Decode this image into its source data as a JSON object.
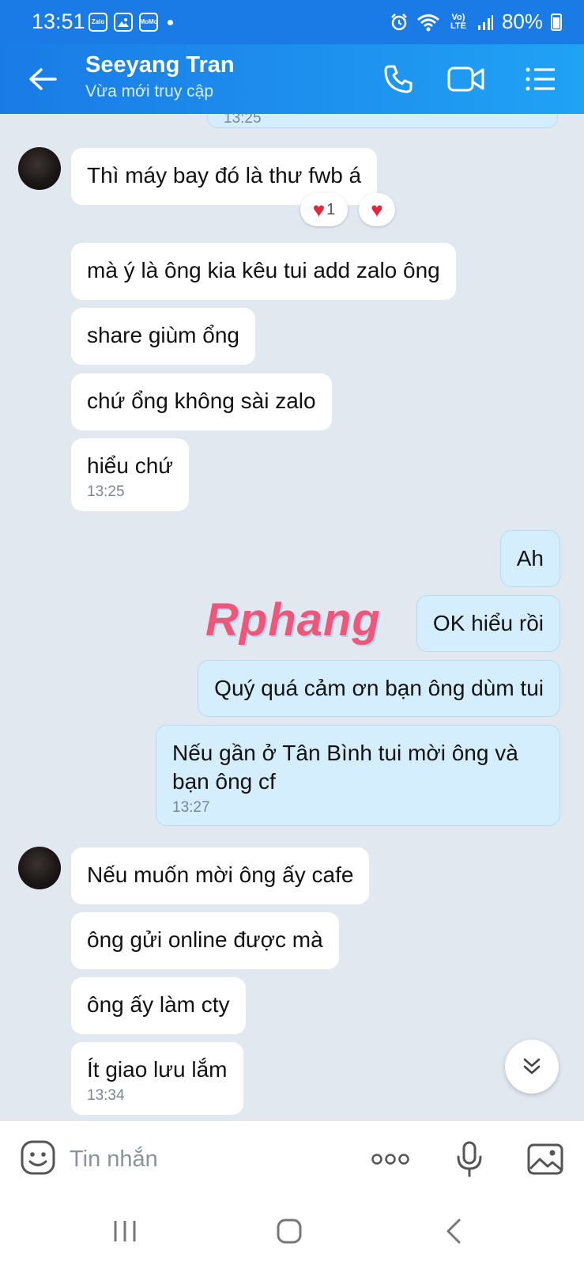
{
  "status_bar": {
    "time": "13:51",
    "app_icons": [
      "Zalo",
      "gallery",
      "MoMo"
    ],
    "network": "Vo) LTE",
    "battery": "80%"
  },
  "header": {
    "contact_name": "Seeyang Tran",
    "contact_status": "Vừa mới truy cập",
    "icons": [
      "back-arrow-icon",
      "phone-icon",
      "video-call-icon",
      "menu-icon"
    ]
  },
  "chat": {
    "partial_timestamp": "13:25",
    "messages": [
      {
        "side": "in",
        "text": "Thì máy bay đó là thư fwb á",
        "time": ""
      },
      {
        "side": "in",
        "text": "mà ý là ông kia kêu tui add zalo ông",
        "time": ""
      },
      {
        "side": "in",
        "text": "share giùm ổng",
        "time": ""
      },
      {
        "side": "in",
        "text": "chứ ổng không sài zalo",
        "time": ""
      },
      {
        "side": "in",
        "text": "hiểu chứ",
        "time": "13:25"
      },
      {
        "side": "out",
        "text": "Ah",
        "time": ""
      },
      {
        "side": "out",
        "text": "OK hiểu rồi",
        "time": ""
      },
      {
        "side": "out",
        "text": "Quý quá cảm ơn bạn ông dùm tui",
        "time": ""
      },
      {
        "side": "out",
        "text": "Nếu gần ở Tân Bình tui mời ông và bạn ông cf",
        "time": "13:27"
      },
      {
        "side": "in",
        "text": "Nếu muốn mời ông ấy cafe",
        "time": ""
      },
      {
        "side": "in",
        "text": "ông gửi online được mà",
        "time": ""
      },
      {
        "side": "in",
        "text": "ông ấy làm cty",
        "time": ""
      },
      {
        "side": "in",
        "text": "Ít giao lưu lắm",
        "time": "13:34"
      }
    ],
    "reaction_count": "1",
    "watermark": "Rphang"
  },
  "input_bar": {
    "placeholder": "Tin nhắn",
    "icons": [
      "emoji-icon",
      "more-icon",
      "microphone-icon",
      "image-icon"
    ]
  },
  "nav_bar": {
    "icons": [
      "recent-apps-icon",
      "home-icon",
      "back-icon"
    ]
  },
  "colors": {
    "header_blue": "#1a7be6",
    "incoming_bubble": "#ffffff",
    "outgoing_bubble": "#d4eefd",
    "chat_background": "#e1e8ef",
    "heart": "#e0283b"
  }
}
